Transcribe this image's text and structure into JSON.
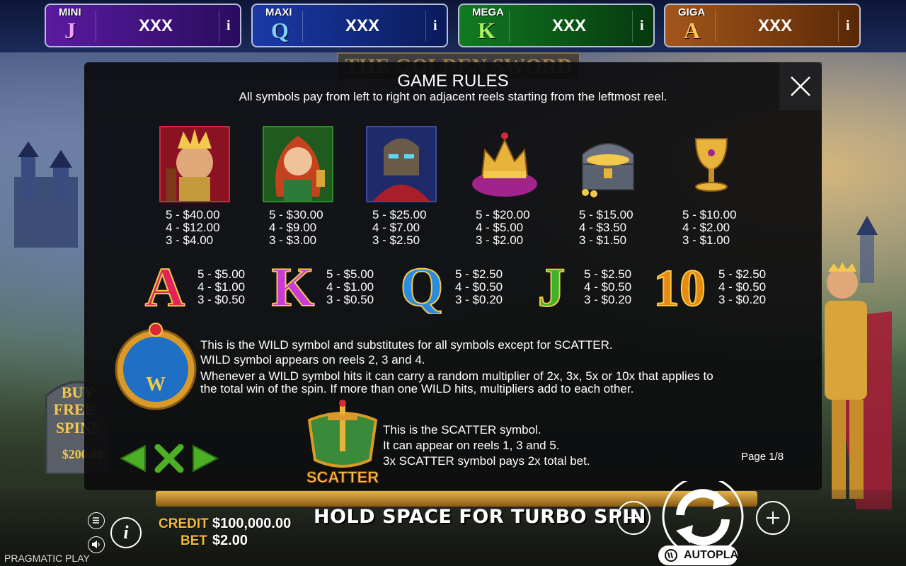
{
  "jackpots": [
    {
      "tier": "MINI",
      "letter": "J",
      "value": "XXX",
      "info": "i"
    },
    {
      "tier": "MAXI",
      "letter": "Q",
      "value": "XXX",
      "info": "i"
    },
    {
      "tier": "MEGA",
      "letter": "K",
      "value": "XXX",
      "info": "i"
    },
    {
      "tier": "GIGA",
      "letter": "A",
      "value": "XXX",
      "info": "i"
    }
  ],
  "rules": {
    "title": "GAME RULES",
    "subtitle": "All symbols pay from left to right on adjacent reels starting from the leftmost reel.",
    "close_icon": "close-icon",
    "high_symbols": [
      {
        "name": "king-symbol",
        "p5": "5 - $40.00",
        "p4": "4 - $12.00",
        "p3": "3 - $4.00"
      },
      {
        "name": "lady-symbol",
        "p5": "5 - $30.00",
        "p4": "4 - $9.00",
        "p3": "3 - $3.00"
      },
      {
        "name": "knight-symbol",
        "p5": "5 - $25.00",
        "p4": "4 - $7.00",
        "p3": "3 - $2.50"
      },
      {
        "name": "crown-symbol",
        "p5": "5 - $20.00",
        "p4": "4 - $5.00",
        "p3": "3 - $2.00"
      },
      {
        "name": "chest-symbol",
        "p5": "5 - $15.00",
        "p4": "4 - $3.50",
        "p3": "3 - $1.50"
      },
      {
        "name": "chalice-symbol",
        "p5": "5 - $10.00",
        "p4": "4 - $2.00",
        "p3": "3 - $1.00"
      }
    ],
    "low_symbols": [
      {
        "letter": "A",
        "color": "#e0245a",
        "p5": "5 - $5.00",
        "p4": "4 - $1.00",
        "p3": "3 - $0.50"
      },
      {
        "letter": "K",
        "color": "#c93ad8",
        "p5": "5 - $5.00",
        "p4": "4 - $1.00",
        "p3": "3 - $0.50"
      },
      {
        "letter": "Q",
        "color": "#2a8be0",
        "p5": "5 - $2.50",
        "p4": "4 - $0.50",
        "p3": "3 - $0.20"
      },
      {
        "letter": "J",
        "color": "#3bb32a",
        "p5": "5 - $2.50",
        "p4": "4 - $0.50",
        "p3": "3 - $0.20"
      },
      {
        "letter": "10",
        "color": "#e88a12",
        "p5": "5 - $2.50",
        "p4": "4 - $0.50",
        "p3": "3 - $0.20"
      }
    ],
    "wild": {
      "symbol_letter": "W",
      "line1": "This is the WILD symbol and substitutes for all symbols except for SCATTER.",
      "line2": "WILD symbol appears on reels 2, 3 and 4.",
      "line3": "Whenever a WILD symbol hits it can carry a random multiplier of 2x, 3x, 5x or 10x that applies to",
      "line4": "the total win of the spin. If more than one WILD hits, multipliers add to each other."
    },
    "scatter": {
      "symbol_label": "SCATTER",
      "line1": "This is the SCATTER symbol.",
      "line2": "It can appear on reels 1, 3 and 5.",
      "line3": "3x SCATTER symbol pays 2x total bet."
    },
    "page": "Page 1/8"
  },
  "logo": "THE GOLDEN SWORD",
  "buy_free_spins": {
    "line1": "BUY",
    "line2": "FREE",
    "line3": "SPINS",
    "price": "$200.00"
  },
  "bottom": {
    "credit_label": "CREDIT",
    "credit_value": "$100,000.00",
    "bet_label": "BET",
    "bet_value": "$2.00",
    "turbo_text": "HOLD SPACE FOR TURBO SPIN",
    "autoplay_label": "AUTOPLAY",
    "info_label": "i",
    "brand": "PRAGMATIC PLAY"
  },
  "colors": {
    "accent_gold": "#f2b935",
    "panel_bg": "#0c0c0e"
  }
}
